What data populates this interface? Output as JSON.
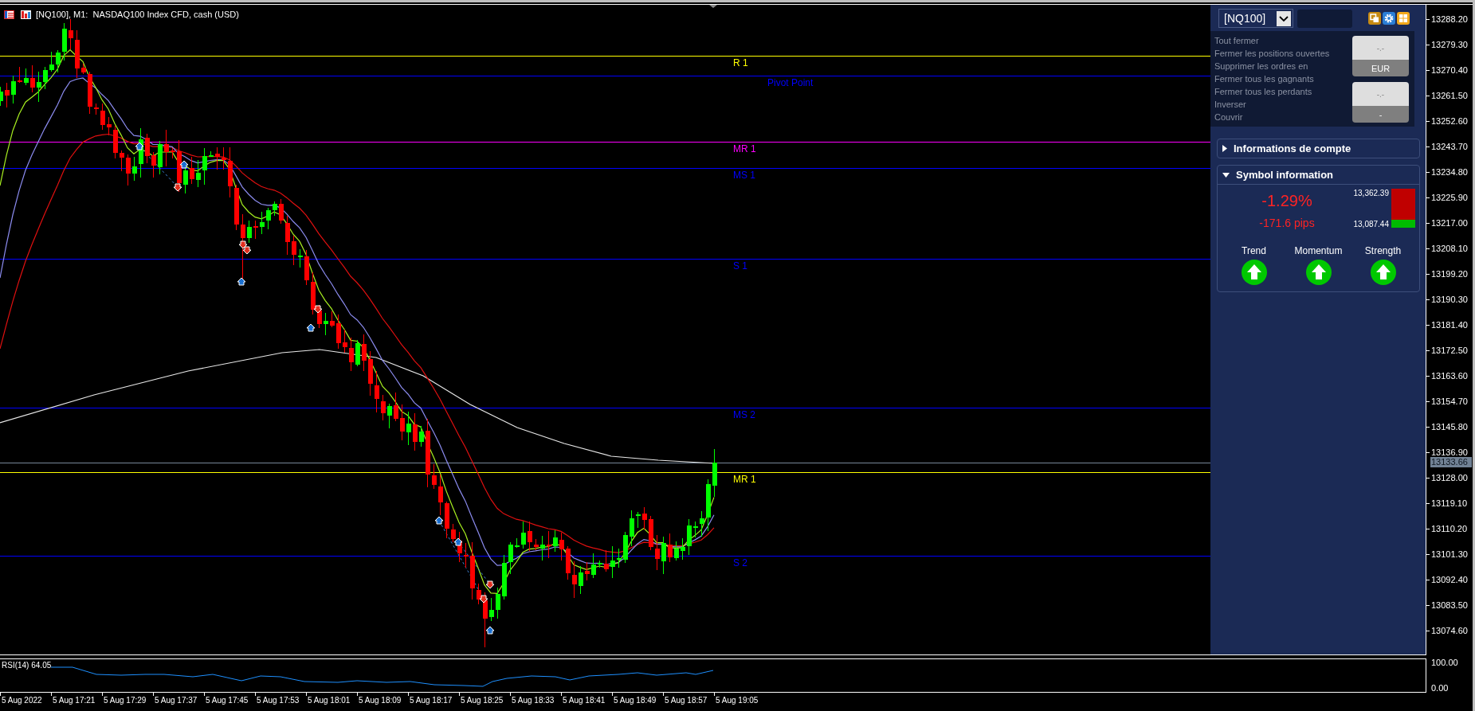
{
  "chart": {
    "title": "[NQ100], M1:  NASDAQ100 Index CFD, cash (USD)",
    "pivot_levels": [
      {
        "label": "R 1",
        "color": "#ffff00"
      },
      {
        "label": "Pivot Point",
        "color": "#0000ff"
      },
      {
        "label": "MR 1",
        "color": "#ff00ff"
      },
      {
        "label": "MS 1",
        "color": "#0000ff"
      },
      {
        "label": "S 1",
        "color": "#0000ff"
      },
      {
        "label": "MS 2",
        "color": "#0000ff"
      },
      {
        "label": "MR 1",
        "color": "#ffff00"
      },
      {
        "label": "S 2",
        "color": "#0000ff"
      }
    ],
    "current_price": "13133.66"
  },
  "price_axis": {
    "ticks": [
      "13288.20",
      "13279.30",
      "13270.40",
      "13261.50",
      "13252.60",
      "13243.70",
      "13234.80",
      "13225.90",
      "13217.00",
      "13208.10",
      "13199.20",
      "13190.30",
      "13181.40",
      "13172.50",
      "13163.60",
      "13154.70",
      "13145.80",
      "13136.90",
      "13128.00",
      "13119.10",
      "13110.20",
      "13101.30",
      "13092.40",
      "13083.50",
      "13074.60"
    ]
  },
  "panel": {
    "symbol_select": {
      "value": "[NQ100]"
    },
    "actions": [
      "Tout fermer",
      "Fermer les positions ouvertes",
      "Supprimer les ordres en",
      "Fermer tous les gagnants",
      "Fermer tous les perdants",
      "Inverser",
      "Couvrir"
    ],
    "totals": [
      {
        "value": "-.-",
        "currency": "EUR"
      },
      {
        "value": "-.-",
        "currency": "-"
      }
    ],
    "sections": [
      {
        "kind": "account",
        "title": "Informations de compte",
        "expanded": false
      },
      {
        "kind": "symbol",
        "title": "Symbol information",
        "expanded": true
      }
    ],
    "symbol_info": {
      "change_percent": "-1.29%",
      "change_pips": "-171.6 pips",
      "high": "13,362.39",
      "low": "13,087.44",
      "range": {
        "level": 0.2
      },
      "indicators": [
        {
          "label": "Trend",
          "rising": true
        },
        {
          "label": "Momentum",
          "rising": true
        },
        {
          "label": "Strength",
          "rising": true
        }
      ]
    }
  },
  "rsi": {
    "label": "RSI(14) 64.05",
    "ticks": [
      "100.00",
      "0.00"
    ]
  },
  "time_axis": {
    "labels": [
      "5 Aug 2022",
      "5 Aug 17:21",
      "5 Aug 17:29",
      "5 Aug 17:37",
      "5 Aug 17:45",
      "5 Aug 17:53",
      "5 Aug 18:01",
      "5 Aug 18:09",
      "5 Aug 18:17",
      "5 Aug 18:25",
      "5 Aug 18:33",
      "5 Aug 18:41",
      "5 Aug 18:49",
      "5 Aug 18:57",
      "5 Aug 19:05"
    ]
  }
}
